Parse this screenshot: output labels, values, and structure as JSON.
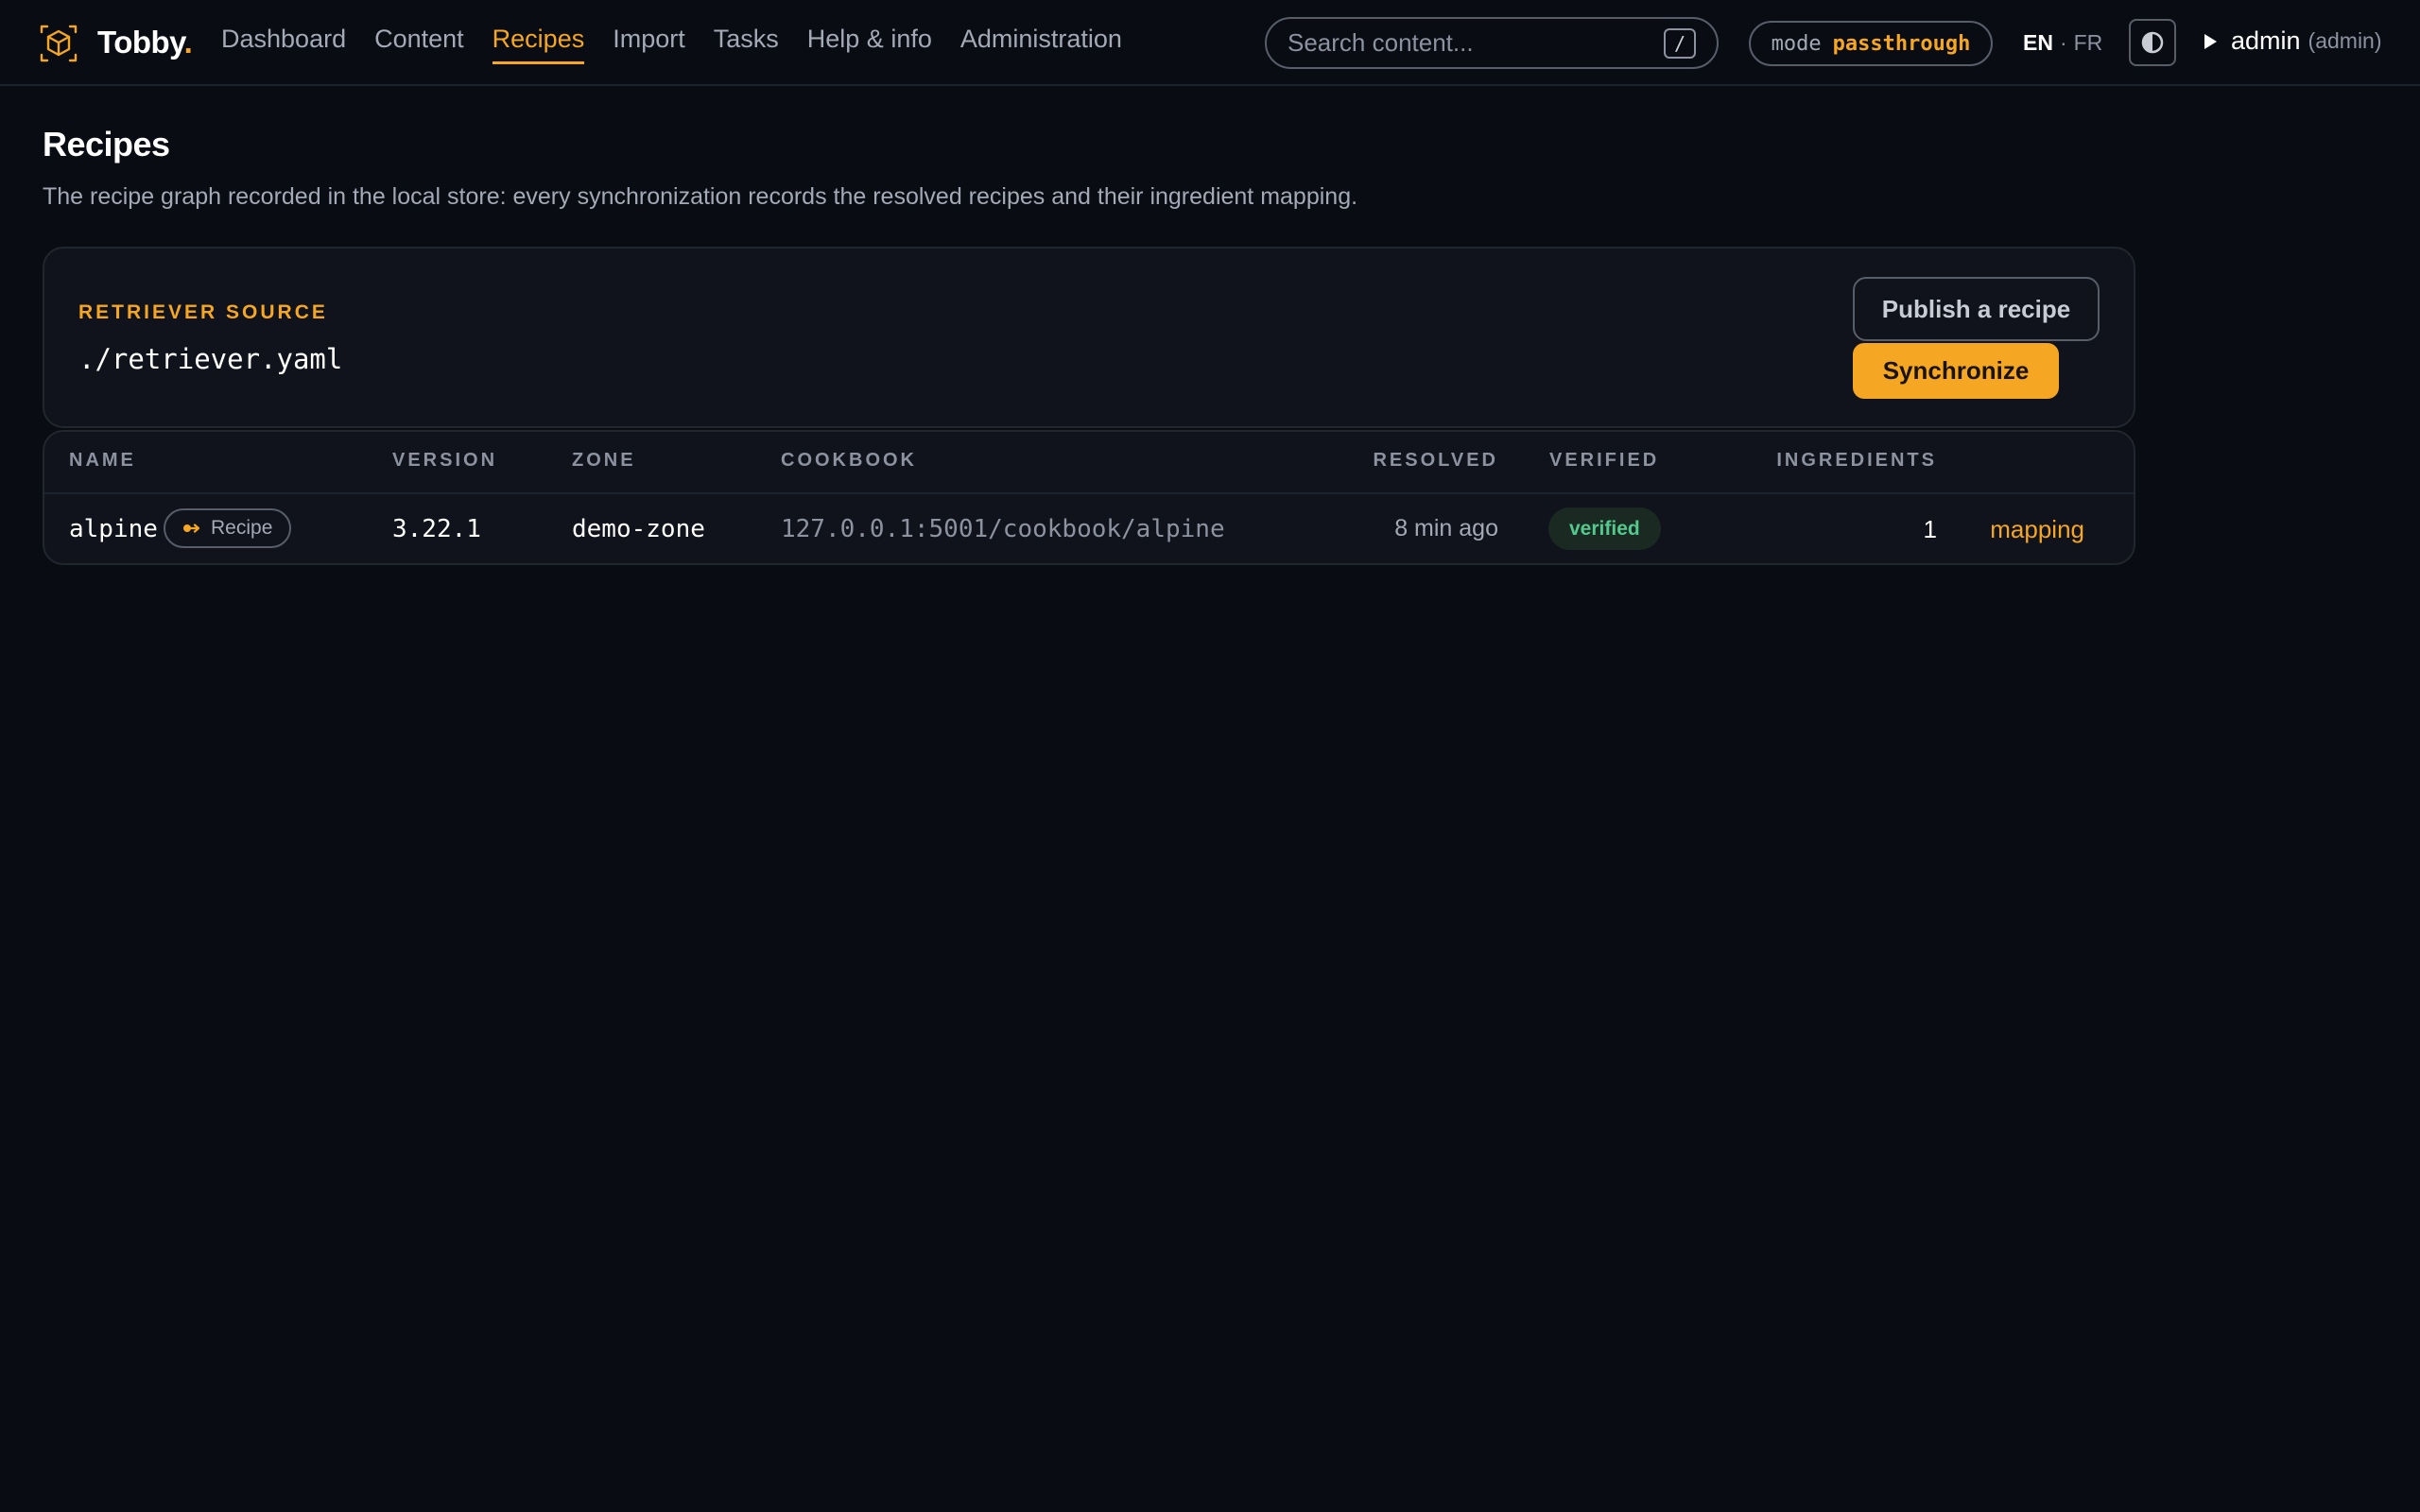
{
  "app": {
    "brand_name": "Tobby",
    "brand_dot": ".",
    "icons": {
      "logo": "cube-logo-icon",
      "theme": "half-circle-contrast-icon",
      "user": "play-triangle-icon",
      "recipe_badge": "link-arrow-icon"
    },
    "colors": {
      "accent": "#f5a623",
      "background": "#0a0c13",
      "card": "#10131b",
      "success": "#53c98d"
    }
  },
  "nav": {
    "items": [
      {
        "label": "Dashboard",
        "active": false
      },
      {
        "label": "Content",
        "active": false
      },
      {
        "label": "Recipes",
        "active": true
      },
      {
        "label": "Import",
        "active": false
      },
      {
        "label": "Tasks",
        "active": false
      },
      {
        "label": "Help & info",
        "active": false
      },
      {
        "label": "Administration",
        "active": false
      }
    ]
  },
  "search": {
    "placeholder": "Search content...",
    "shortcut": "/"
  },
  "mode": {
    "key": "mode",
    "value": "passthrough"
  },
  "lang": {
    "active": "EN",
    "separator": "·",
    "other": "FR"
  },
  "user": {
    "name": "admin",
    "role": "(admin)"
  },
  "page": {
    "title": "Recipes",
    "description": "The recipe graph recorded in the local store: every synchronization records the resolved recipes and their ingredient mapping."
  },
  "source": {
    "label": "RETRIEVER SOURCE",
    "path": "./retriever.yaml",
    "publish_label": "Publish a recipe",
    "sync_label": "Synchronize"
  },
  "table": {
    "columns": {
      "name": "NAME",
      "version": "VERSION",
      "zone": "ZONE",
      "cookbook": "COOKBOOK",
      "resolved": "RESOLVED",
      "verified": "VERIFIED",
      "ingredients": "INGREDIENTS"
    },
    "rows": [
      {
        "name": "alpine",
        "badge": "Recipe",
        "version": "3.22.1",
        "zone": "demo-zone",
        "cookbook": "127.0.0.1:5001/cookbook/alpine",
        "resolved": "8 min ago",
        "verified": "verified",
        "ingredients": "1",
        "action": "mapping"
      }
    ]
  }
}
